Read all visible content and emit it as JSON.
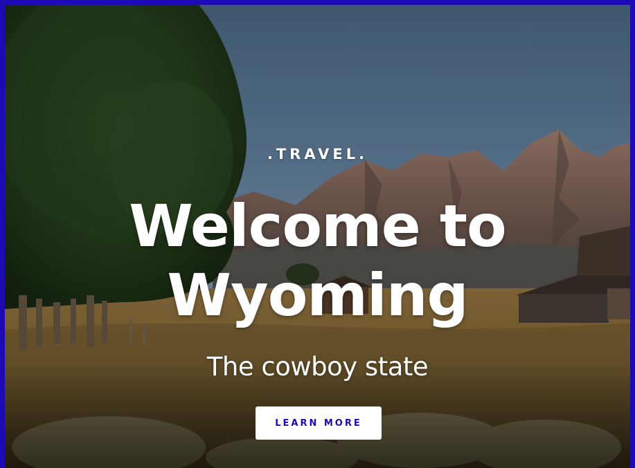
{
  "hero": {
    "eyebrow": ".TRAVEL.",
    "headline_line1": "Welcome to",
    "headline_line2": "Wyoming",
    "subtitle": "The cowboy state",
    "cta_label": "LEARN MORE",
    "image_subject": "grand-teton-mormon-row-barn-landscape"
  },
  "colors": {
    "frame": "#1e0ab4",
    "cta_text": "#1e0ab4",
    "cta_bg": "#ffffff",
    "text": "#ffffff"
  }
}
